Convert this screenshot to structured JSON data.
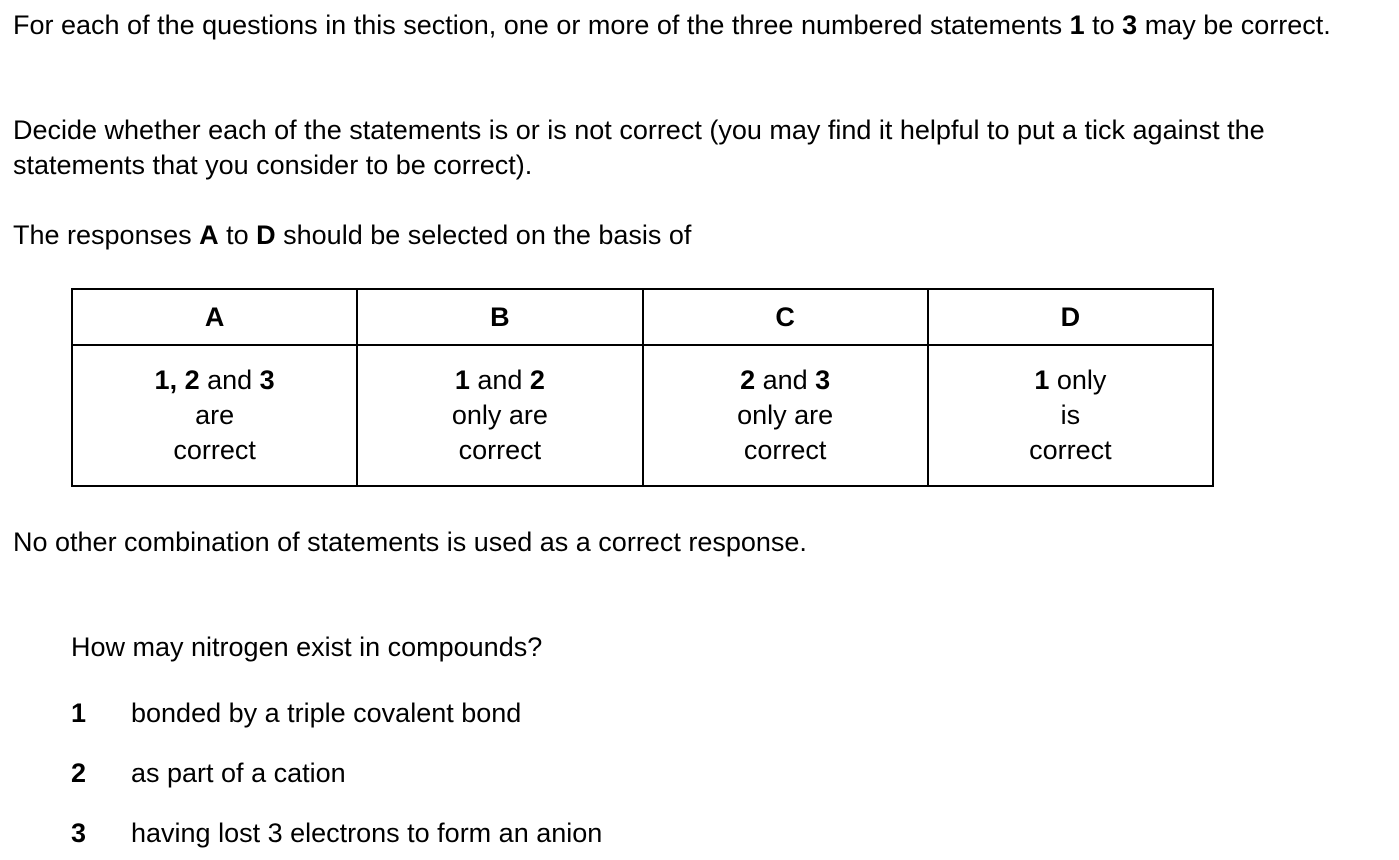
{
  "instructions": {
    "p1": {
      "a": "For each of the questions in this section, one or more of the three numbered statements ",
      "b1": "1",
      "c": " to ",
      "b2": "3",
      "d": " may be correct."
    },
    "p2": "Decide whether each of the statements is or is not correct (you may find it helpful to put a tick against the statements that you consider to be correct).",
    "p3": {
      "a": "The responses ",
      "b1": "A",
      "c": " to ",
      "b2": "D",
      "d": " should be selected on the basis of"
    },
    "p4": "No other combination of statements is used as a correct response."
  },
  "responses": [
    {
      "letter": "A",
      "nums": "1, 2",
      "mid": " and ",
      "last": "3",
      "line2": "are",
      "line3": "correct"
    },
    {
      "letter": "B",
      "nums": "1",
      "mid": " and ",
      "last": "2",
      "line2": "only are",
      "line3": "correct"
    },
    {
      "letter": "C",
      "nums": "2",
      "mid": " and ",
      "last": "3",
      "line2": "only are",
      "line3": "correct"
    },
    {
      "letter": "D",
      "nums": "1",
      "mid": " only",
      "last": "",
      "line2": "is",
      "line3": "correct"
    }
  ],
  "question": {
    "text": "How may nitrogen exist in compounds?",
    "statements": [
      {
        "num": "1",
        "text": "bonded by a triple covalent bond"
      },
      {
        "num": "2",
        "text": "as part of a cation"
      },
      {
        "num": "3",
        "text": "having lost 3 electrons to form an anion"
      }
    ]
  }
}
